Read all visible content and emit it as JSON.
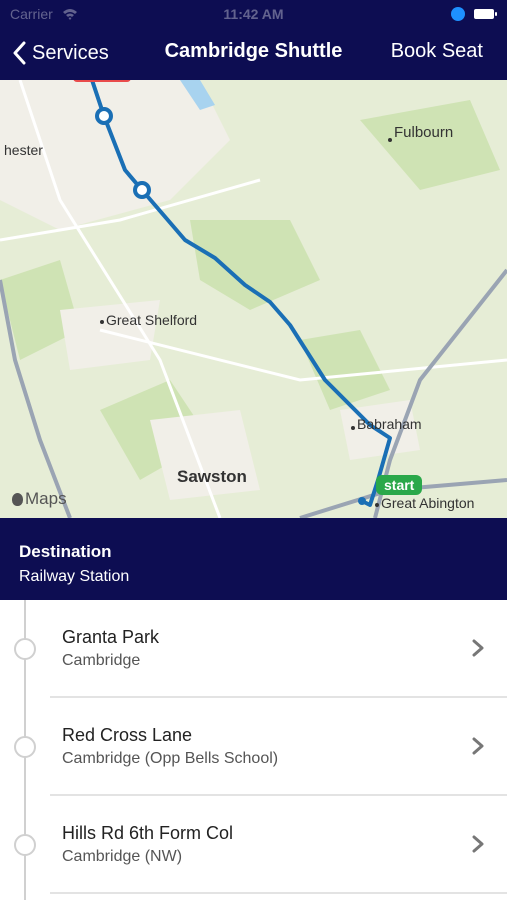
{
  "status_bar": {
    "carrier": "Carrier",
    "time": "11:42 AM"
  },
  "header": {
    "back_label": "Services",
    "title": "Cambridge Shuttle",
    "action_label": "Book Seat"
  },
  "map": {
    "places": [
      "Fulbourn",
      "hester",
      "Great Shelford",
      "Babraham",
      "Sawston",
      "Great Abington"
    ],
    "start_label": "start",
    "attribution": "Maps",
    "route_color": "#1a6fb5",
    "start_color": "#2aa84a"
  },
  "destination": {
    "title": "Destination",
    "value": "Railway Station"
  },
  "stops": [
    {
      "name": "Granta Park",
      "sub": "Cambridge"
    },
    {
      "name": "Red Cross Lane",
      "sub": "Cambridge (Opp Bells School)"
    },
    {
      "name": "Hills Rd 6th Form Col",
      "sub": "Cambridge (NW)"
    }
  ]
}
